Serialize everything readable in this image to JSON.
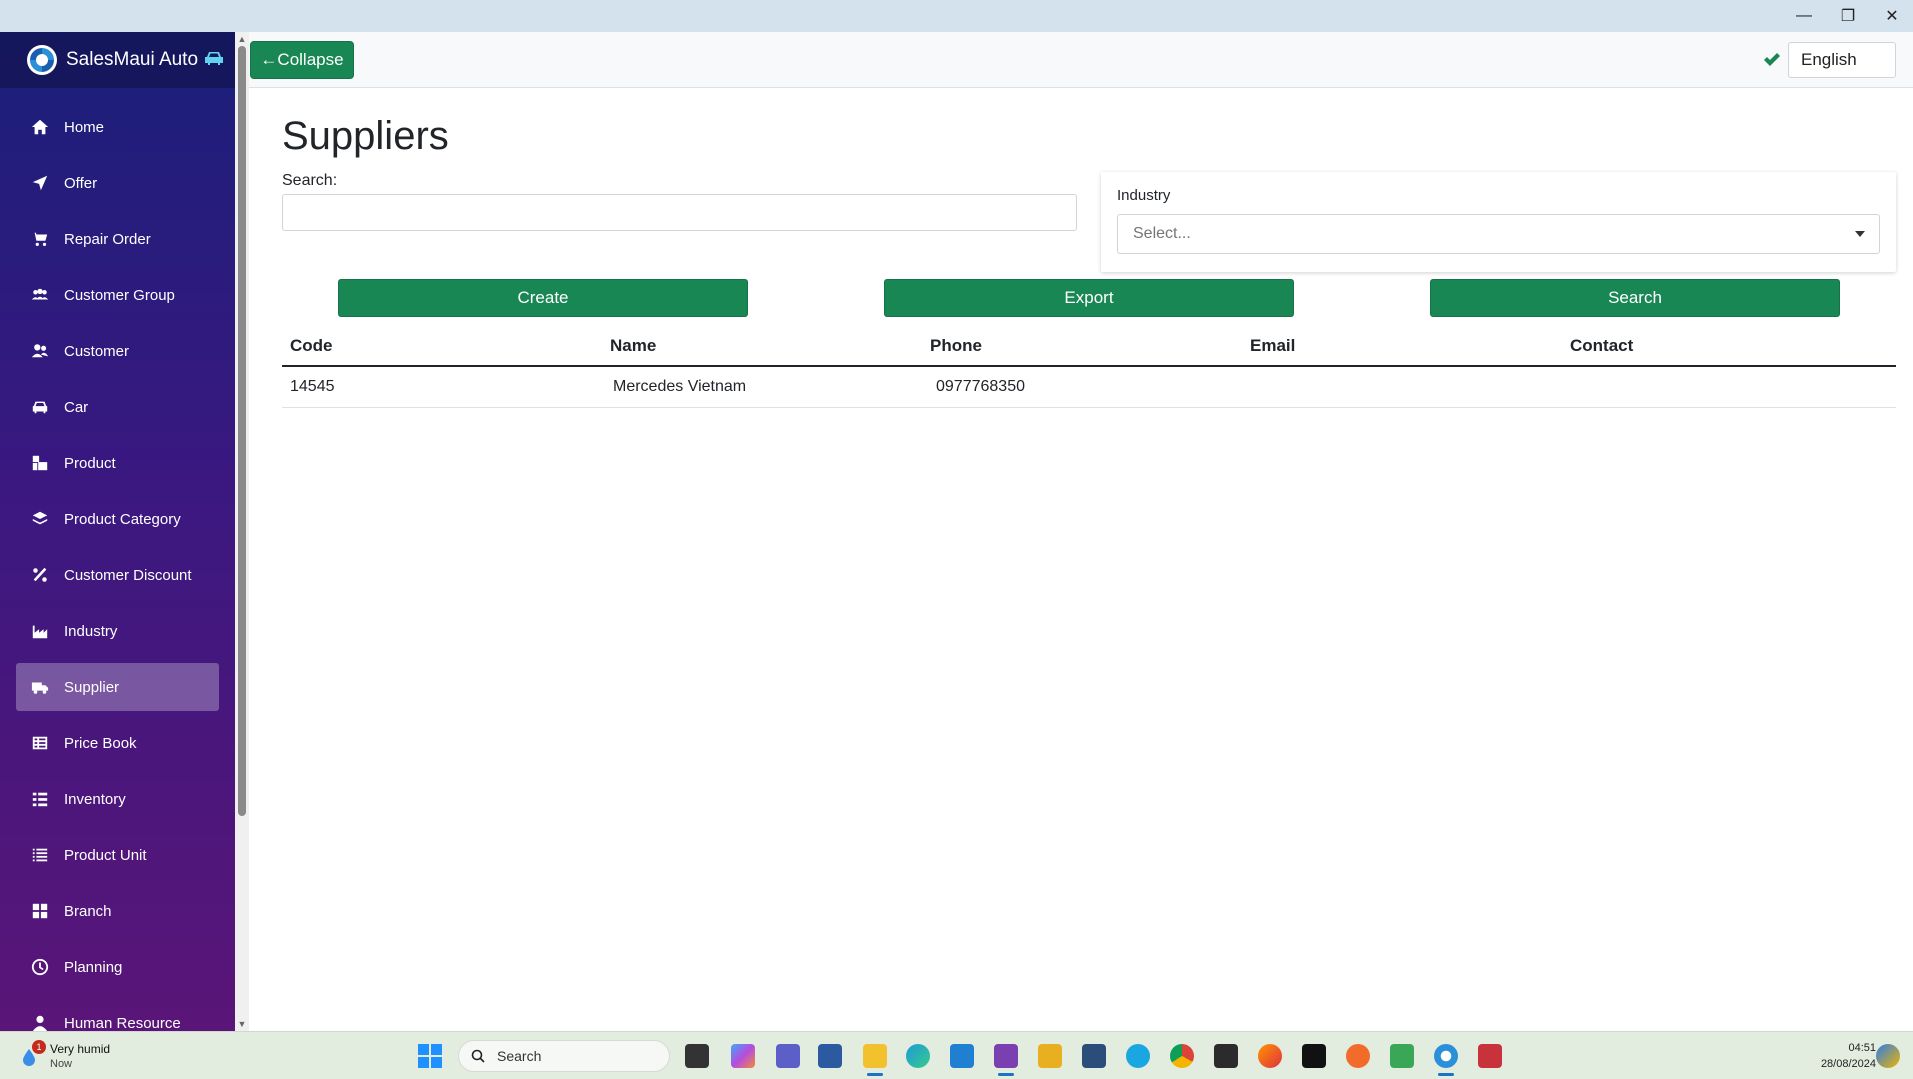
{
  "app": {
    "brand": "SalesMaui Auto"
  },
  "window": {
    "minimize": "—",
    "restore": "❐",
    "close": "✕"
  },
  "header": {
    "collapse_label": "←Collapse",
    "language": "English"
  },
  "sidebar": {
    "items": [
      {
        "label": "Home",
        "icon": "home-icon"
      },
      {
        "label": "Offer",
        "icon": "paper-plane-icon"
      },
      {
        "label": "Repair Order",
        "icon": "cart-icon"
      },
      {
        "label": "Customer Group",
        "icon": "users-icon"
      },
      {
        "label": "Customer",
        "icon": "user-friends-icon"
      },
      {
        "label": "Car",
        "icon": "car-icon"
      },
      {
        "label": "Product",
        "icon": "boxes-icon"
      },
      {
        "label": "Product Category",
        "icon": "layers-icon"
      },
      {
        "label": "Customer Discount",
        "icon": "percent-icon"
      },
      {
        "label": "Industry",
        "icon": "industry-icon"
      },
      {
        "label": "Supplier",
        "icon": "truck-icon",
        "active": true
      },
      {
        "label": "Price Book",
        "icon": "table-icon"
      },
      {
        "label": "Inventory",
        "icon": "list-check-icon"
      },
      {
        "label": "Product Unit",
        "icon": "list-icon"
      },
      {
        "label": "Branch",
        "icon": "grid-icon"
      },
      {
        "label": "Planning",
        "icon": "clock-icon"
      },
      {
        "label": "Human Resource",
        "icon": "user-icon"
      }
    ]
  },
  "main": {
    "title": "Suppliers",
    "search_label": "Search:",
    "search_value": "",
    "industry_label": "Industry",
    "industry_placeholder": "Select...",
    "buttons": {
      "create": "Create",
      "export": "Export",
      "search": "Search"
    },
    "table": {
      "columns": [
        "Code",
        "Name",
        "Phone",
        "Email",
        "Contact"
      ],
      "rows": [
        {
          "code": "14545",
          "name": "Mercedes Vietnam",
          "phone": "0977768350",
          "email": "",
          "contact": ""
        }
      ]
    }
  },
  "taskbar": {
    "weather_title": "Very humid",
    "weather_sub": "Now",
    "weather_badge": "1",
    "search_placeholder": "Search",
    "time": "04:51",
    "date": "28/08/2024"
  },
  "colors": {
    "primary_green": "#198754",
    "sidebar_top": "#1a1f7a",
    "sidebar_bottom": "#5a1578"
  }
}
